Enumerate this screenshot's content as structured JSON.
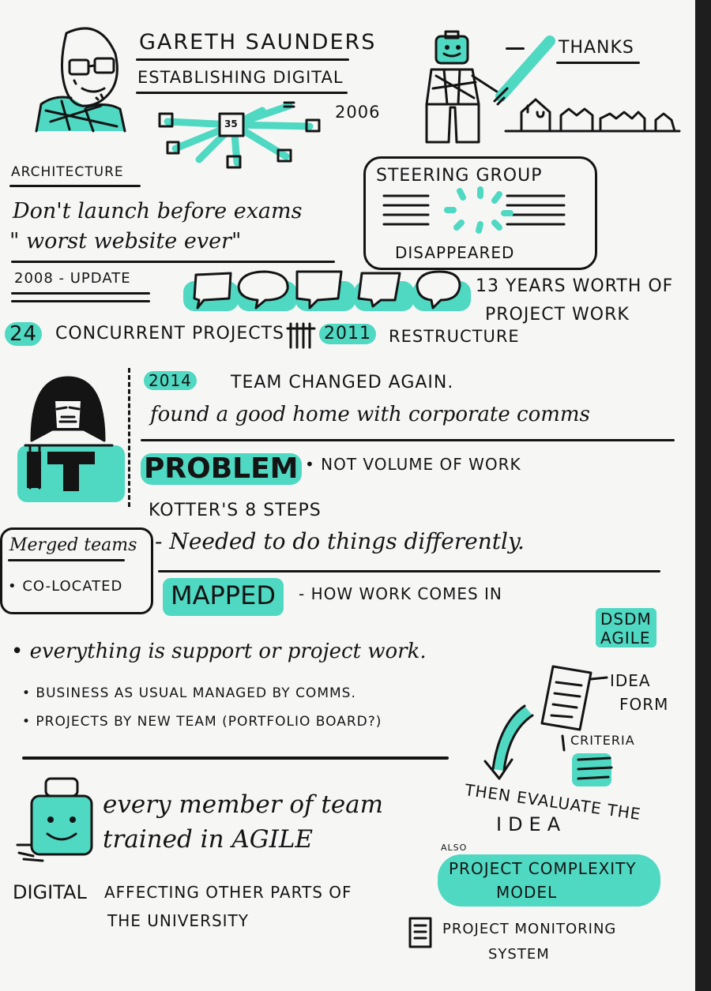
{
  "header": {
    "name": "Gareth Saunders",
    "subtitle": "Establishing digital",
    "thanks": "Thanks"
  },
  "architecture": {
    "year": "2006",
    "center_label": "35",
    "heading": "Architecture",
    "line1": "Don't launch before exams",
    "line2": "\" worst website ever\""
  },
  "steering": {
    "title": "Steering group",
    "status": "Disappeared"
  },
  "timeline": {
    "update": "2008 - update",
    "years_1": "13 years worth of",
    "years_2": "project work",
    "concurrent_num": "24",
    "concurrent_text": "concurrent projects",
    "restructure_year": "2011",
    "restructure_text": "restructure"
  },
  "team": {
    "year": "2014",
    "changed": "Team changed again.",
    "home": "found a good home with corporate comms"
  },
  "problem": {
    "label": "Problem",
    "point": "• Not volume of work",
    "kotter": "Kotter's 8 steps",
    "differently": "- Needed to do things differently."
  },
  "merged": {
    "title": "Merged teams",
    "point": "• Co-located"
  },
  "mapped": {
    "label": "Mapped",
    "text": "- How work comes in",
    "bullet1": "• everything is support or project work.",
    "bullet2": "• Business as usual managed by comms.",
    "bullet3": "• Projects by new team (portfolio board?)"
  },
  "agile": {
    "label_1": "DSDM",
    "label_2": "Agile",
    "idea_1": "Idea",
    "idea_2": "form",
    "criteria": "Criteria",
    "evaluate_1": "Then evaluate the",
    "evaluate_2": "idea",
    "also": "Also",
    "complexity_1": "Project complexity",
    "complexity_2": "model",
    "monitoring_1": "Project monitoring",
    "monitoring_2": "system"
  },
  "training": {
    "line1": "every member of team",
    "line2": "trained in AGILE"
  },
  "digital": {
    "label": "Digital",
    "text_1": "Affecting other parts of",
    "text_2": "the University"
  }
}
